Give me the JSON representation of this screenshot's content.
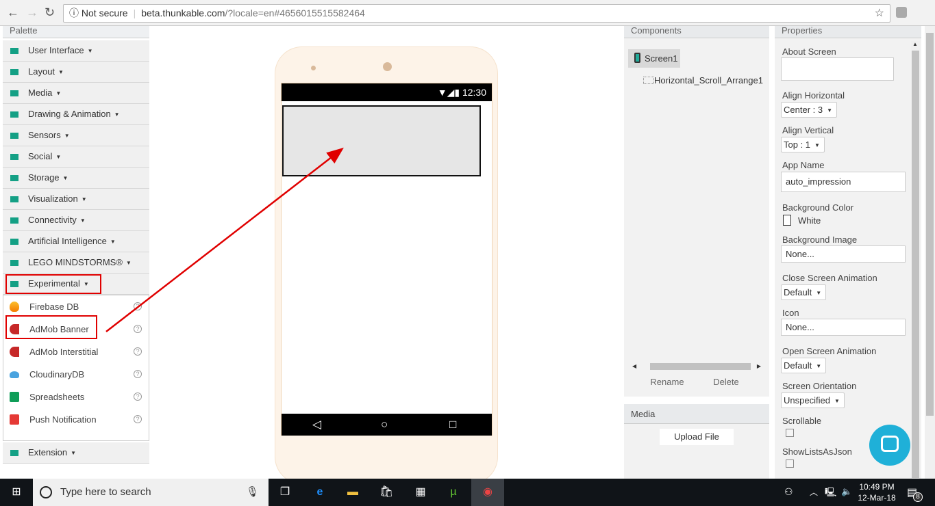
{
  "browser": {
    "security": "Not secure",
    "url_host": "beta.thunkable.com",
    "url_path": "/?locale=en#4656015515582464"
  },
  "palette": {
    "title": "Palette",
    "categories": [
      "User Interface",
      "Layout",
      "Media",
      "Drawing & Animation",
      "Sensors",
      "Social",
      "Storage",
      "Visualization",
      "Connectivity",
      "Artificial Intelligence",
      "LEGO MINDSTORMS®",
      "Experimental"
    ],
    "experimental_items": [
      {
        "label": "Firebase DB",
        "icon": "firebase-icon"
      },
      {
        "label": "AdMob Banner",
        "icon": "admob-icon"
      },
      {
        "label": "AdMob Interstitial",
        "icon": "admob-icon"
      },
      {
        "label": "CloudinaryDB",
        "icon": "cloudinary-icon"
      },
      {
        "label": "Spreadsheets",
        "icon": "sheets-icon"
      },
      {
        "label": "Push Notification",
        "icon": "push-icon"
      }
    ],
    "extension": "Extension",
    "help": "?"
  },
  "phone": {
    "time": "12:30"
  },
  "components": {
    "title": "Components",
    "screen": "Screen1",
    "child": "Horizontal_Scroll_Arrange1",
    "rename": "Rename",
    "delete": "Delete"
  },
  "media": {
    "title": "Media",
    "upload": "Upload File"
  },
  "properties": {
    "title": "Properties",
    "about_screen": "About Screen",
    "align_h": "Align Horizontal",
    "align_h_val": "Center : 3",
    "align_v": "Align Vertical",
    "align_v_val": "Top : 1",
    "app_name": "App Name",
    "app_name_val": "auto_impression",
    "bg_color": "Background Color",
    "bg_color_val": "White",
    "bg_image": "Background Image",
    "bg_image_val": "None...",
    "close_anim": "Close Screen Animation",
    "close_anim_val": "Default",
    "icon": "Icon",
    "icon_val": "None...",
    "open_anim": "Open Screen Animation",
    "open_anim_val": "Default",
    "orientation": "Screen Orientation",
    "orientation_val": "Unspecified",
    "scrollable": "Scrollable",
    "showlists": "ShowListsAsJson"
  },
  "taskbar": {
    "search": "Type here to search",
    "time": "10:49 PM",
    "date": "12-Mar-18",
    "notifications": "8"
  },
  "colors": {
    "accent": "#14a085",
    "annotation": "#e00000"
  }
}
